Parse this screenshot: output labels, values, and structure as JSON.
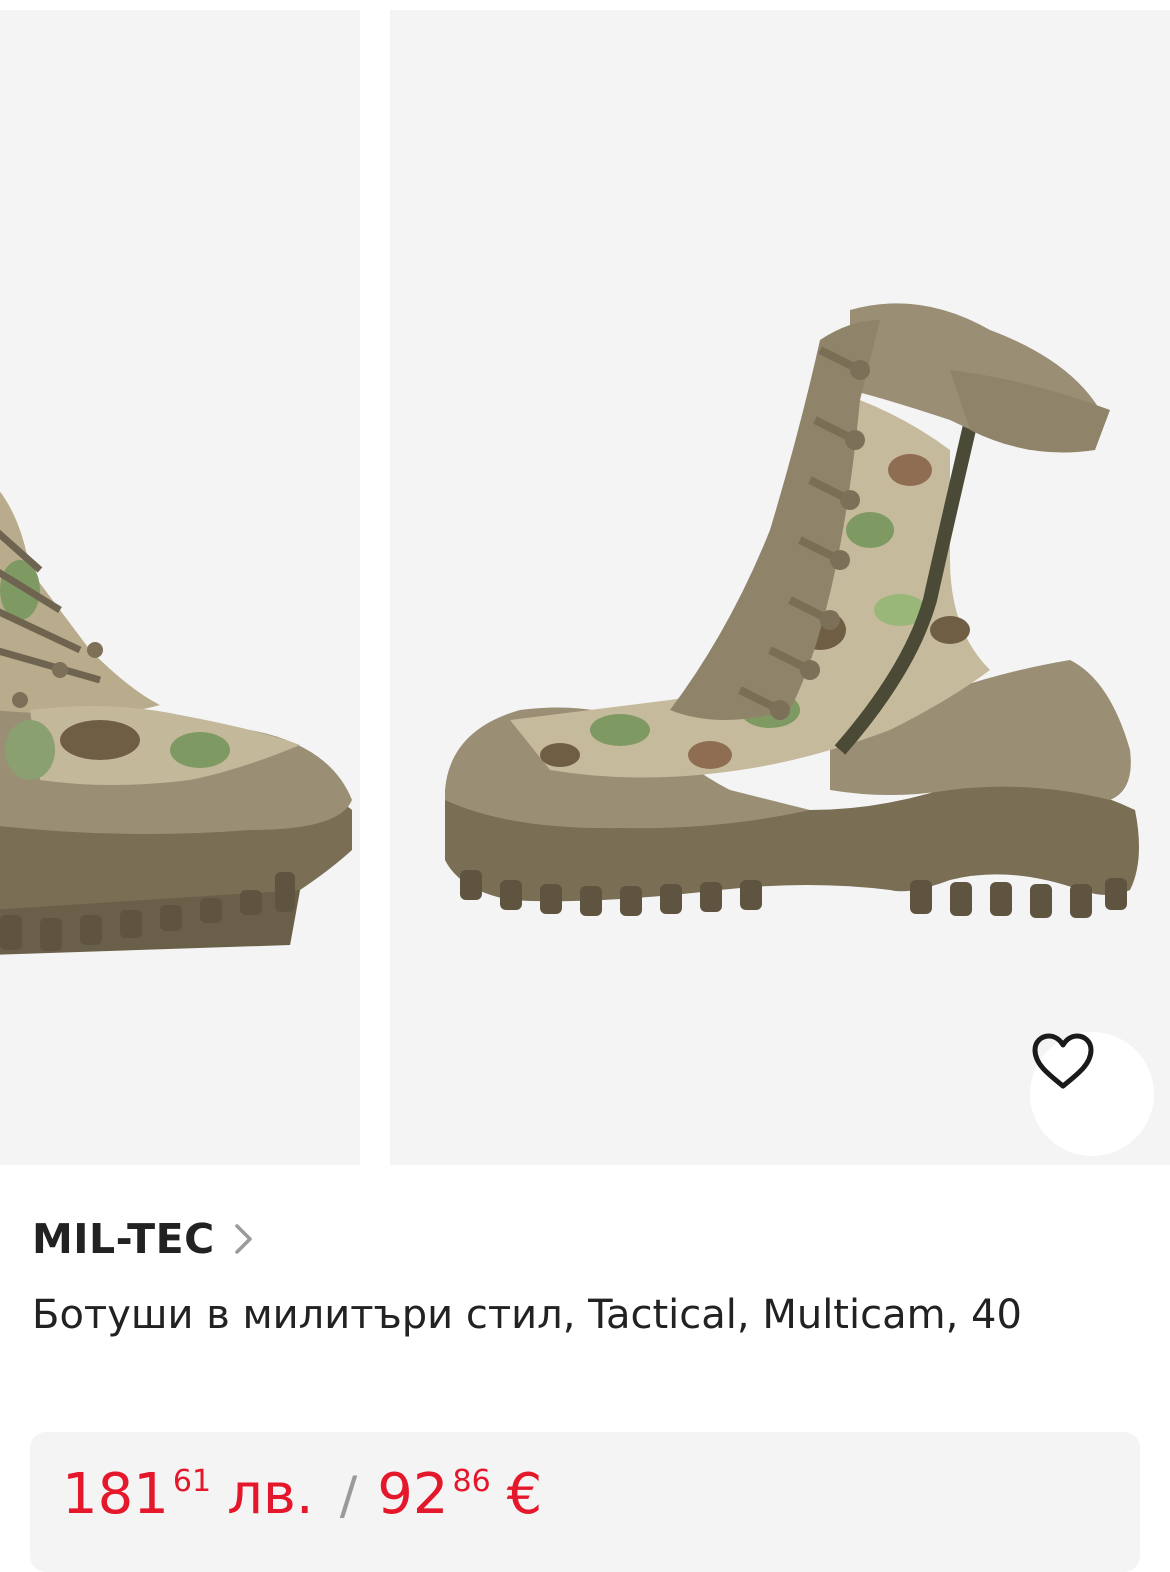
{
  "gallery": {
    "images": [
      {
        "alt": "Boot side view (partial)",
        "icon": "boot-image"
      },
      {
        "alt": "Boot side view with zipper",
        "icon": "boot-image"
      }
    ],
    "favorite_icon": "heart-outline-icon"
  },
  "product": {
    "brand": "MIL-TEC",
    "brand_chevron_icon": "chevron-right-icon",
    "title": "Ботуши в милитъри стил, Tactical, Multicam, 40"
  },
  "price": {
    "bgn_int": "181",
    "bgn_dec": "61",
    "bgn_currency": "лв.",
    "separator": "/",
    "eur_int": "92",
    "eur_dec": "86",
    "eur_currency": "€"
  },
  "colors": {
    "price": "#e4172b",
    "slide_bg": "#f4f4f4",
    "price_box_bg": "#f4f4f4"
  }
}
